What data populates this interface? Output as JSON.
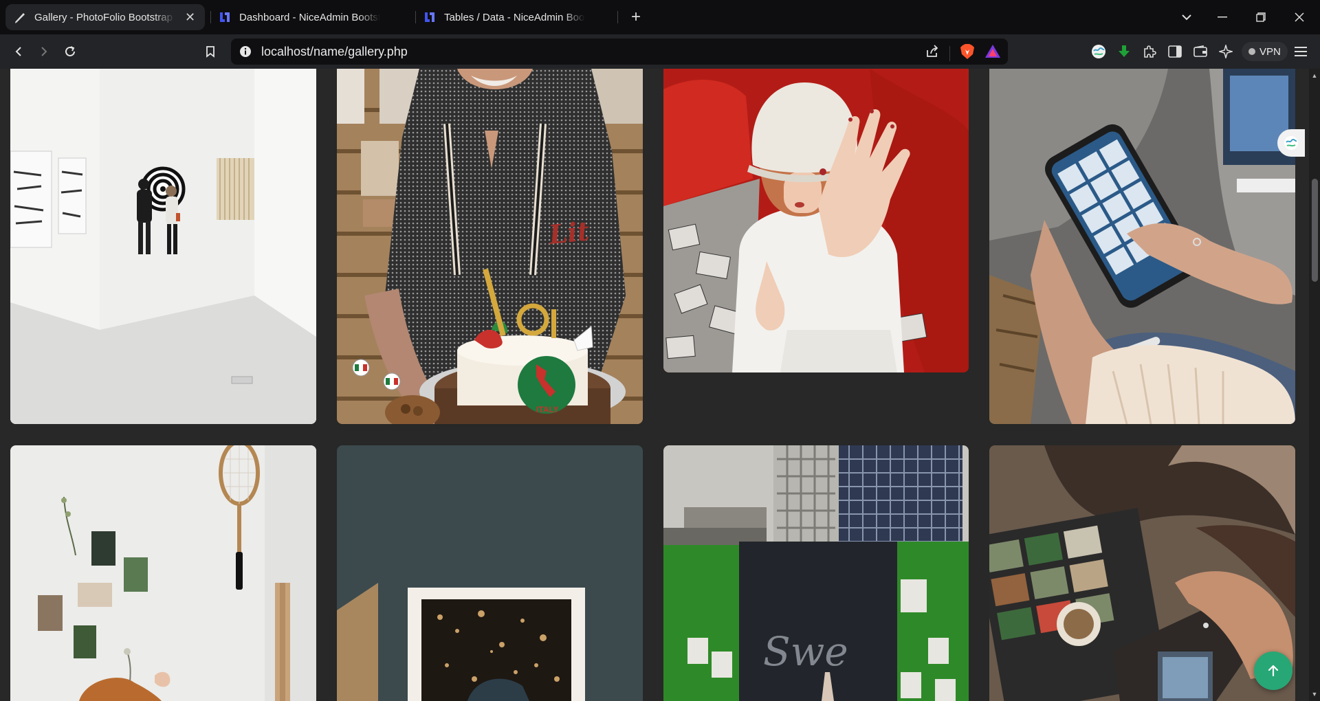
{
  "browser": {
    "tabs": [
      {
        "title": "Gallery - PhotoFolio Bootstrap",
        "active": true,
        "favicon": "photofolio-pen-icon"
      },
      {
        "title": "Dashboard - NiceAdmin Bootstrap",
        "active": false,
        "favicon": "niceadmin-logo-icon"
      },
      {
        "title": "Tables / Data - NiceAdmin Bootstrap",
        "active": false,
        "favicon": "niceadmin-logo-icon"
      }
    ],
    "url": "localhost/name/gallery.php",
    "vpn_label": "VPN",
    "accent": "#27a776"
  },
  "gallery": {
    "photos": [
      {
        "subject": "white art gallery with couple viewing spiral artwork"
      },
      {
        "subject": "elderly woman with birthday cake number 91"
      },
      {
        "subject": "girl in white bucket hat on red sofa raising hand"
      },
      {
        "subject": "hands holding smartphone showing photo grid"
      },
      {
        "subject": "white wall with badminton racket and pinned photos"
      },
      {
        "subject": "framed photo of bokeh lights against teal wall"
      },
      {
        "subject": "green construction hoarding with posters below office tower"
      },
      {
        "subject": "hands holding camera in front of laptop with photos"
      }
    ],
    "cake_text": "ITALY",
    "wall_text": "Swe"
  }
}
